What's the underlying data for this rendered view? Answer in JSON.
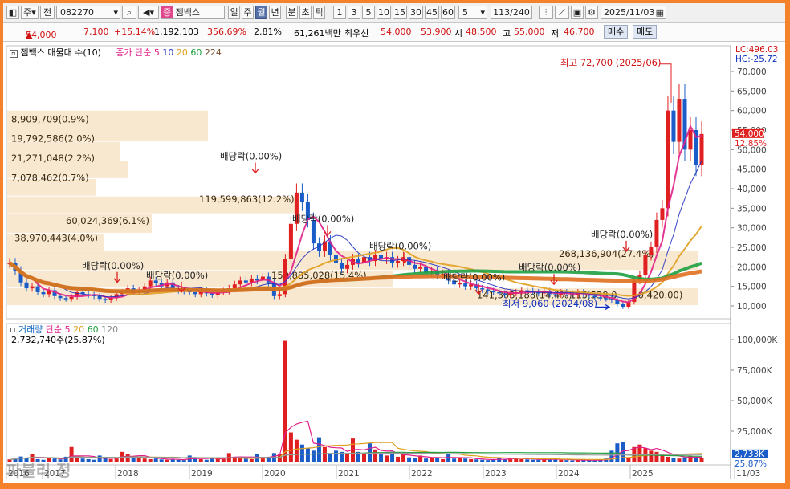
{
  "toolbar": {
    "type_label": "주",
    "prev_label": "전",
    "code": "082270",
    "stock_name": "젬백스",
    "stock_badge": "증",
    "periods": [
      "일",
      "주",
      "월",
      "년",
      "분",
      "초",
      "틱"
    ],
    "selected_period": "월",
    "nums": [
      "1",
      "3",
      "5",
      "10",
      "15",
      "30",
      "45",
      "60"
    ],
    "count": "5",
    "page": "113/240",
    "date": "2025/11/03"
  },
  "quote": {
    "price": "54,000",
    "change": "7,100",
    "change_pct": "+15.14%",
    "volume": "1,192,103",
    "volume_pct": "356.69%",
    "turnover": "2.81%",
    "amount": "61,261백만",
    "priority_label": "최우선",
    "ask": "54,000",
    "bid": "53,900",
    "open_label": "시",
    "open": "48,500",
    "high_label": "고",
    "high": "55,000",
    "low_label": "저",
    "low": "46,700",
    "buy_label": "매수",
    "sell_label": "매도"
  },
  "price_panel": {
    "legend_title": "젬백스 매물대 수(10)",
    "ma_label": "종가 단순",
    "ma_periods": [
      "5",
      "10",
      "20",
      "60",
      "224"
    ],
    "ma_colors": [
      "#e0208a",
      "#2030c0",
      "#e0a020",
      "#20a040",
      "#7a5030"
    ],
    "lc": "LC:496.03",
    "hc": "HC:-25.72",
    "y_ticks": [
      "70,000",
      "65,000",
      "60,000",
      "55,000",
      "50,000",
      "45,000",
      "40,000",
      "35,000",
      "30,000",
      "25,000",
      "20,000",
      "15,000",
      "10,000"
    ],
    "current_price_tag": "54,000",
    "current_pct_tag": "12.85%",
    "high_note": "최고 72,700 (2025/06)",
    "low_note": "최저 9,060 (2024/08)",
    "volume_profile": [
      "8,909,709(0.9%)",
      "19,792,586(2.0%)",
      "21,271,048(2.2%)",
      "7,078,462(0.7%)",
      "119,599,863(12.2%)",
      "60,024,369(6.1%)",
      "38,970,443(4.0%)",
      "268,136,904(27.4%)",
      "150,885,028(15.4%)",
      "141,303,188(14.4%)",
      "115,538,0",
      "~ 10,420.00)"
    ],
    "dividend_label": "배당락(0.00%)"
  },
  "volume_panel": {
    "legend_title": "거래량",
    "ma_label": "단순",
    "ma_periods": [
      "5",
      "20",
      "60",
      "120"
    ],
    "value_note": "2,732,740주(25.87%)",
    "y_ticks": [
      "100,000K",
      "75,000K",
      "50,000K",
      "25,000K"
    ],
    "tag_value": "2,733K",
    "tag_pct": "25.87%"
  },
  "x_axis": {
    "labels": [
      "2016",
      "2017",
      "2018",
      "2019",
      "2020",
      "2021",
      "2022",
      "2023",
      "2024",
      "2025",
      "11/03"
    ]
  },
  "watermark": "파블리 정"
}
